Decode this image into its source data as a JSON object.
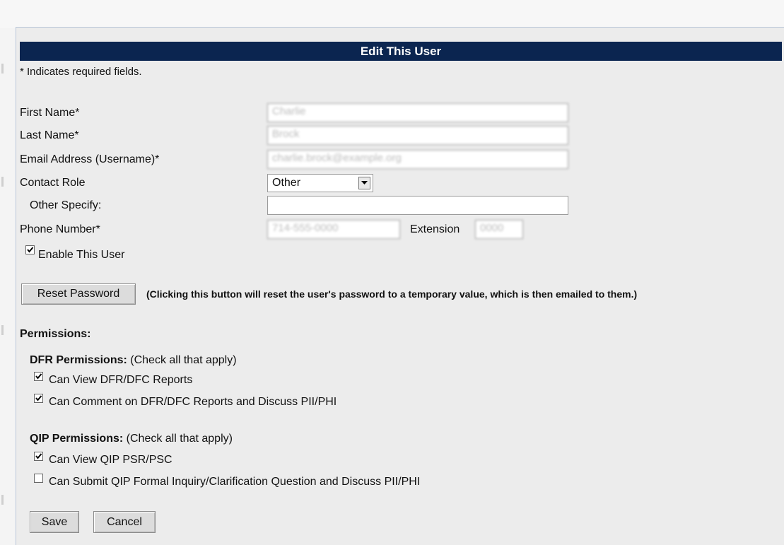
{
  "form": {
    "title": "Edit This User",
    "required_note": "* Indicates required fields.",
    "first_name_label": "First Name*",
    "first_name_value": "Charlie",
    "last_name_label": "Last Name*",
    "last_name_value": "Brock",
    "email_label": "Email Address (Username)*",
    "email_value": "charlie.brock@example.org",
    "contact_role_label": "Contact Role",
    "contact_role_value": "Other",
    "other_specify_label": "Other Specify:",
    "other_specify_value": "",
    "phone_label": "Phone Number*",
    "phone_value": "714-555-0000",
    "extension_label": "Extension",
    "extension_value": "0000",
    "enable_user_label": "Enable This User",
    "enable_user_checked": true,
    "reset_button_label": "Reset Password",
    "reset_note": "(Clicking this button will reset the user's password to a temporary value, which is then emailed to them.)"
  },
  "permissions": {
    "heading": "Permissions:",
    "dfr": {
      "heading": "DFR Permissions:",
      "hint": "(Check all that apply)",
      "items": [
        {
          "label": "Can View DFR/DFC Reports",
          "checked": true
        },
        {
          "label": "Can Comment on DFR/DFC Reports and Discuss PII/PHI",
          "checked": true
        }
      ]
    },
    "qip": {
      "heading": "QIP Permissions:",
      "hint": "(Check all that apply)",
      "items": [
        {
          "label": "Can View QIP PSR/PSC",
          "checked": true
        },
        {
          "label": "Can Submit QIP Formal Inquiry/Clarification Question and Discuss PII/PHI",
          "checked": false
        }
      ]
    }
  },
  "actions": {
    "save_label": "Save",
    "cancel_label": "Cancel"
  },
  "colors": {
    "title_bar": "#0b2550",
    "panel_bg": "#ececec"
  }
}
